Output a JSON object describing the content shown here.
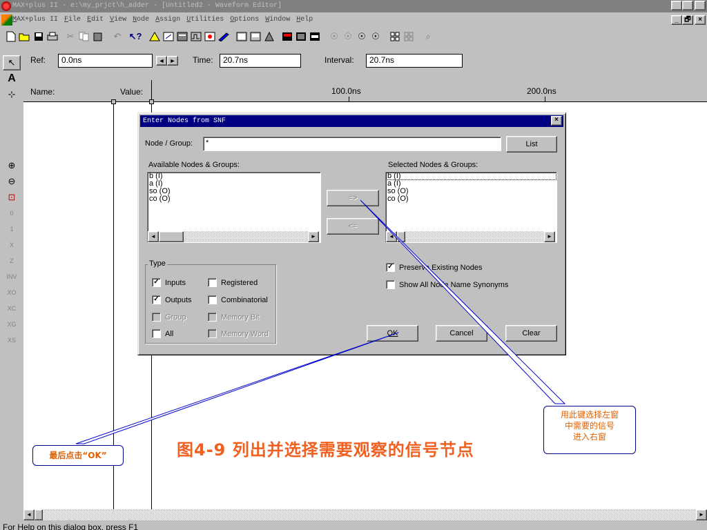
{
  "window": {
    "title": "MAX+plus II - e:\\my_prjct\\h_adder - [Untitled2 - Waveform Editor]",
    "app_menu_label": "MAX+plus II",
    "menus": [
      "File",
      "Edit",
      "View",
      "Node",
      "Assign",
      "Utilities",
      "Options",
      "Window",
      "Help"
    ],
    "minimize": "_",
    "maximize": "□",
    "restore": "🗗",
    "close": "×"
  },
  "toolbar_icons": [
    "new-icon",
    "open-icon",
    "save-icon",
    "print-icon",
    "cut-icon",
    "copy-icon",
    "paste-icon",
    "undo-icon",
    "help-cursor-icon",
    "hierarchy-icon",
    "floorplan-icon",
    "compile-icon",
    "simulate-icon",
    "timing-icon",
    "program-icon",
    "open-editor-icon",
    "save-check-icon",
    "save-compile-icon",
    "save-simulate-icon",
    "report-icon",
    "close-icon",
    "find-icon",
    "wizard-icon",
    "probe-icon",
    "node-icon",
    "tile-icon",
    "cascade-icon",
    "zoom-icon"
  ],
  "palette": {
    "pointer": "↖",
    "text": "A",
    "snap": "⊹",
    "zoom_in": "⊕",
    "zoom_out": "⊖",
    "fit": "⊡",
    "levels": [
      "0",
      "1",
      "X",
      "Z",
      "INV",
      "XO",
      "XC",
      "XG",
      "XS"
    ]
  },
  "editor": {
    "ref_label": "Ref:",
    "ref_value": "0.0ns",
    "time_label": "Time:",
    "time_value": "20.7ns",
    "interval_label": "Interval:",
    "interval_value": "20.7ns",
    "name_label": "Name:",
    "value_label": "Value:",
    "scale": [
      "100.0ns",
      "200.0ns"
    ],
    "arrow_left": "◄",
    "arrow_right": "►"
  },
  "dialog": {
    "title": "Enter Nodes from SNF",
    "close": "×",
    "node_group_label": "Node / Group:",
    "node_group_value": "*",
    "list_button": "List",
    "available_label": "Available Nodes & Groups:",
    "available_items": [
      "b (I)",
      "a (I)",
      "so (O)",
      "co (O)"
    ],
    "selected_label": "Selected Nodes & Groups:",
    "selected_items": [
      "b (I)",
      "a (I)",
      "so (O)",
      "co (O)"
    ],
    "add_button": "=>",
    "remove_button": "<=",
    "type_group": "Type",
    "type_options": {
      "inputs": {
        "label": "Inputs",
        "checked": true
      },
      "registered": {
        "label": "Registered",
        "checked": false
      },
      "outputs": {
        "label": "Outputs",
        "checked": true
      },
      "combinatorial": {
        "label": "Combinatorial",
        "checked": false
      },
      "group": {
        "label": "Group",
        "checked": false
      },
      "memory_bit": {
        "label": "Memory Bit",
        "checked": false
      },
      "all": {
        "label": "All",
        "checked": false
      },
      "memory_word": {
        "label": "Memory Word",
        "checked": false
      }
    },
    "preserve": {
      "label": "Preserve Existing Nodes",
      "checked": true
    },
    "show_all": {
      "label": "Show All Node Name Synonyms",
      "checked": false
    },
    "ok_button": "OK",
    "cancel_button": "Cancel",
    "clear_button": "Clear",
    "check_mark": "✓"
  },
  "annotations": {
    "right_callout": [
      "用此键选择左窗",
      "中需要的信号",
      "进入右窗"
    ],
    "left_callout": "最后点击“OK”",
    "caption": "图4-9  列出并选择需要观察的信号节点",
    "colors": {
      "callout_text": "#e06000",
      "line": "#0000cc",
      "caption": "#f06020"
    }
  },
  "status": "For Help on this dialog box, press F1"
}
